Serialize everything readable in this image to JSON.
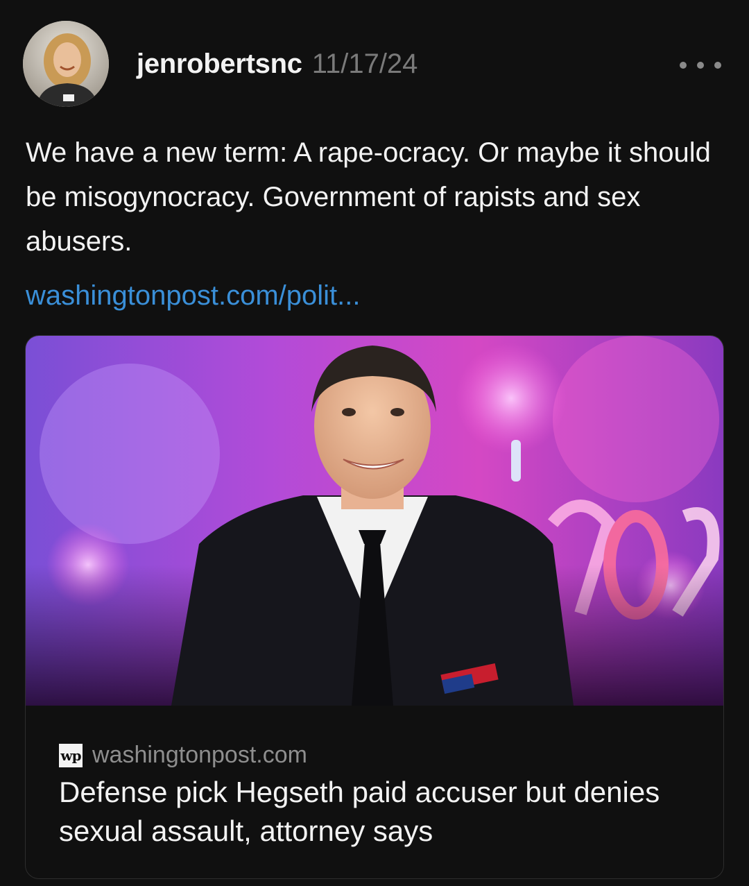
{
  "post": {
    "username": "jenrobertsnc",
    "timestamp": "11/17/24",
    "text": "We have a new term: A rape-ocracy. Or maybe it should be misogynocracy. Government of rapists and sex abusers.",
    "link_text": "washingtonpost.com/polit..."
  },
  "link_card": {
    "source_logo": "wp",
    "source_domain": "washingtonpost.com",
    "title": "Defense pick Hegseth paid accuser but denies sexual assault, attorney says"
  },
  "colors": {
    "background": "#101010",
    "text": "#f3f3f3",
    "muted": "#7a7a7a",
    "link": "#3a8fd8",
    "card_border": "#2e2e2e"
  },
  "icons": {
    "more": "more-horizontal-icon",
    "source": "washington-post-logo-icon"
  }
}
